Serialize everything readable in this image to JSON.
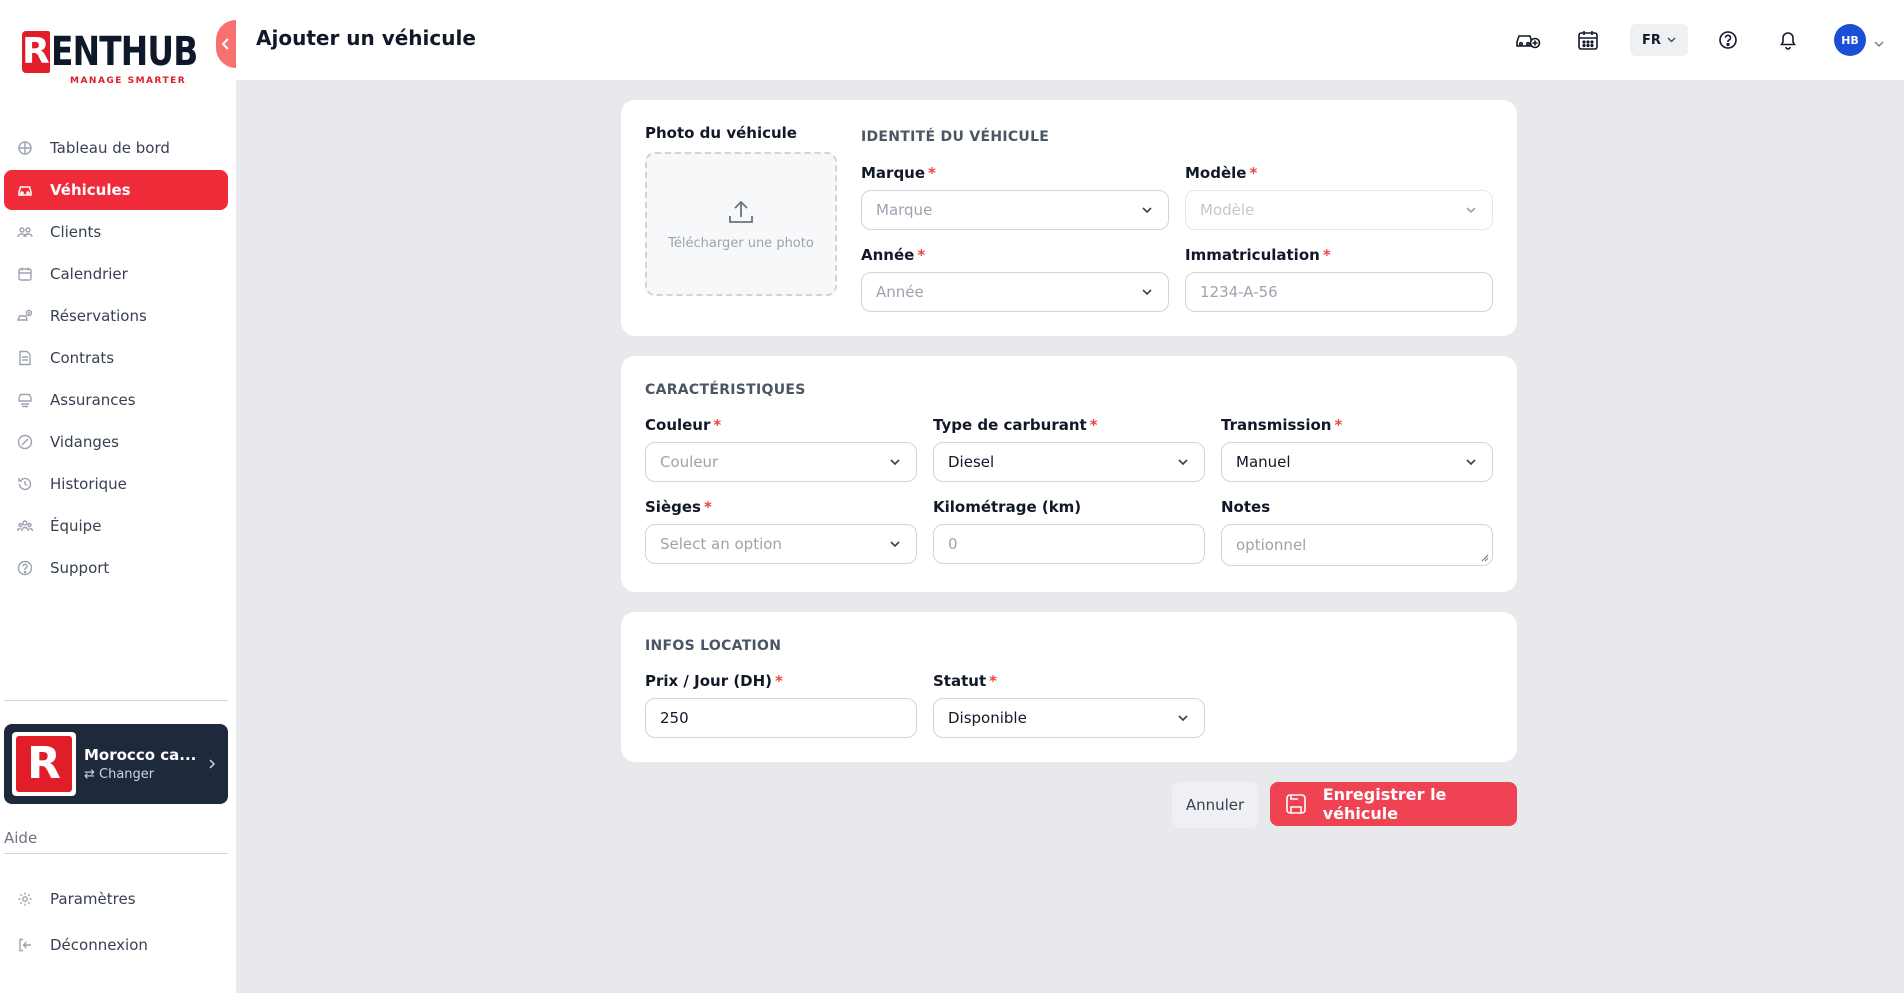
{
  "brand": {
    "logo_letter": "R",
    "logo_text": "ENTHUB",
    "tagline": "MANAGE SMARTER",
    "accent": "#ef2b3a"
  },
  "header": {
    "title": "Ajouter un véhicule",
    "language": "FR",
    "avatar_initials": "HB"
  },
  "sidebar": {
    "items": [
      {
        "label": "Tableau de bord",
        "icon": "dashboard-icon"
      },
      {
        "label": "Véhicules",
        "icon": "car-icon",
        "active": true
      },
      {
        "label": "Clients",
        "icon": "users-icon"
      },
      {
        "label": "Calendrier",
        "icon": "calendar-icon"
      },
      {
        "label": "Réservations",
        "icon": "booking-icon"
      },
      {
        "label": "Contrats",
        "icon": "document-icon"
      },
      {
        "label": "Assurances",
        "icon": "insurance-icon"
      },
      {
        "label": "Vidanges",
        "icon": "oil-icon"
      },
      {
        "label": "Historique",
        "icon": "history-icon"
      },
      {
        "label": "Équipe",
        "icon": "team-icon"
      },
      {
        "label": "Support",
        "icon": "help-icon"
      }
    ],
    "company": {
      "name": "Morocco ca...",
      "change_label": "⇄ Changer"
    },
    "aide_label": "Aide",
    "bottom_items": [
      {
        "label": "Paramètres",
        "icon": "settings-icon"
      },
      {
        "label": "Déconnexion",
        "icon": "logout-icon"
      }
    ]
  },
  "identity": {
    "photo_label": "Photo du véhicule",
    "upload_text": "Télécharger une photo",
    "section_title": "IDENTITÉ DU VÉHICULE",
    "marque_label": "Marque",
    "marque_placeholder": "Marque",
    "modele_label": "Modèle",
    "modele_placeholder": "Modèle",
    "annee_label": "Année",
    "annee_placeholder": "Année",
    "immat_label": "Immatriculation",
    "immat_placeholder": "1234-A-56"
  },
  "features": {
    "section_title": "CARACTÉRISTIQUES",
    "couleur_label": "Couleur",
    "couleur_placeholder": "Couleur",
    "carburant_label": "Type de carburant",
    "carburant_value": "Diesel",
    "transmission_label": "Transmission",
    "transmission_value": "Manuel",
    "sieges_label": "Sièges",
    "sieges_placeholder": "Select an option",
    "km_label": "Kilométrage (km)",
    "km_placeholder": "0",
    "notes_label": "Notes",
    "notes_placeholder": "optionnel"
  },
  "rental": {
    "section_title": "INFOS LOCATION",
    "prix_label": "Prix / Jour (DH)",
    "prix_value": "250",
    "statut_label": "Statut",
    "statut_value": "Disponible"
  },
  "actions": {
    "cancel_label": "Annuler",
    "save_label": "Enregistrer le véhicule"
  },
  "required_mark": "*"
}
